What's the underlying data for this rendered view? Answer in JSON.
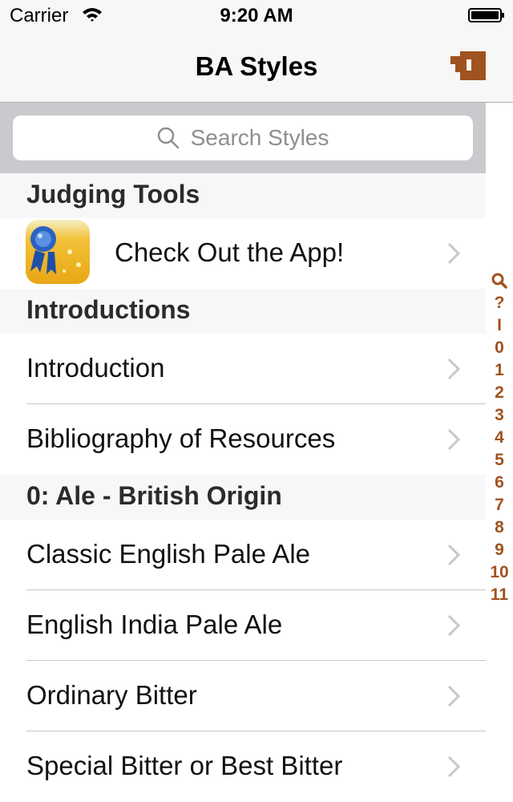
{
  "status_bar": {
    "carrier": "Carrier",
    "time": "9:20 AM"
  },
  "nav": {
    "title": "BA Styles"
  },
  "search": {
    "placeholder": "Search Styles"
  },
  "sections": [
    {
      "header": "Judging Tools",
      "rows": [
        {
          "label": "Check Out the App!"
        }
      ]
    },
    {
      "header": "Introductions",
      "rows": [
        {
          "label": "Introduction"
        },
        {
          "label": "Bibliography of Resources"
        }
      ]
    },
    {
      "header": "0: Ale - British Origin",
      "rows": [
        {
          "label": "Classic English Pale Ale"
        },
        {
          "label": "English India Pale Ale"
        },
        {
          "label": "Ordinary Bitter"
        },
        {
          "label": "Special Bitter or Best Bitter"
        }
      ]
    }
  ],
  "index": [
    "?",
    "I",
    "0",
    "1",
    "2",
    "3",
    "4",
    "5",
    "6",
    "7",
    "8",
    "9",
    "10",
    "11"
  ],
  "colors": {
    "accent": "#a0521f",
    "nav_bg": "#f7f7f7",
    "search_bar_bg": "#c9c9ce"
  },
  "icons": {
    "wifi": "wifi-icon",
    "battery": "battery-icon",
    "mug": "beer-mug-icon",
    "search": "search-icon",
    "chevron": "chevron-right-icon",
    "app": "ribbon-app-icon"
  }
}
